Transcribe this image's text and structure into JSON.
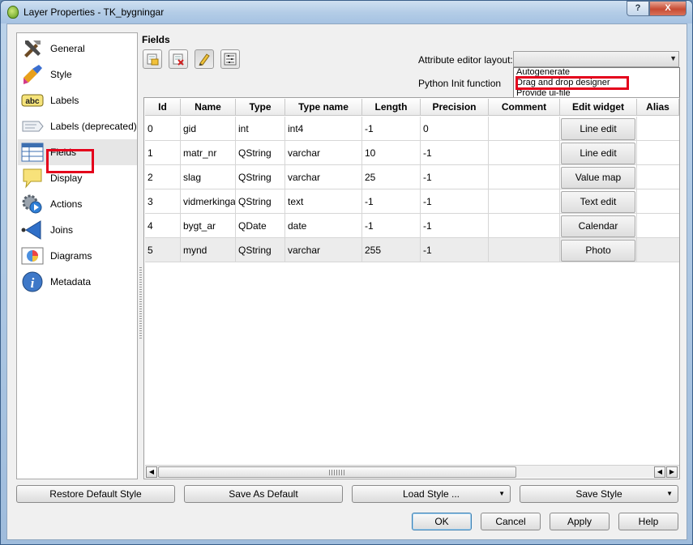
{
  "window": {
    "title": "Layer Properties - TK_bygningar",
    "help_label": "?",
    "close_label": "X"
  },
  "sidebar": {
    "items": [
      {
        "label": "General",
        "icon": "tools-icon"
      },
      {
        "label": "Style",
        "icon": "paintbrush-icon"
      },
      {
        "label": "Labels",
        "icon": "abc-label-icon"
      },
      {
        "label": "Labels (deprecated)",
        "icon": "label-tag-icon"
      },
      {
        "label": "Fields",
        "icon": "table-icon"
      },
      {
        "label": "Display",
        "icon": "speech-bubble-icon"
      },
      {
        "label": "Actions",
        "icon": "gear-play-icon"
      },
      {
        "label": "Joins",
        "icon": "join-arrow-icon"
      },
      {
        "label": "Diagrams",
        "icon": "pie-chart-icon"
      },
      {
        "label": "Metadata",
        "icon": "info-icon"
      }
    ],
    "selected": "Fields"
  },
  "main": {
    "title": "Fields",
    "toolbar": [
      {
        "name": "new-field",
        "icon": "new-field-icon"
      },
      {
        "name": "delete-field",
        "icon": "delete-field-icon"
      },
      {
        "name": "toggle-editing",
        "icon": "pencil-icon",
        "checked": true
      },
      {
        "name": "field-calculator",
        "icon": "calculator-icon"
      }
    ],
    "attr_editor_label": "Attribute editor layout:",
    "python_init_label": "Python Init function",
    "layout_combo": {
      "value": "",
      "options": [
        "Autogenerate",
        "Drag and drop designer",
        "Provide ui-file"
      ]
    }
  },
  "table": {
    "columns": [
      "Id",
      "Name",
      "Type",
      "Type name",
      "Length",
      "Precision",
      "Comment",
      "Edit widget",
      "Alias"
    ],
    "rows": [
      {
        "id": "0",
        "name": "gid",
        "type": "int",
        "typename": "int4",
        "length": "-1",
        "precision": "0",
        "comment": "",
        "widget": "Line edit",
        "alias": ""
      },
      {
        "id": "1",
        "name": "matr_nr",
        "type": "QString",
        "typename": "varchar",
        "length": "10",
        "precision": "-1",
        "comment": "",
        "widget": "Line edit",
        "alias": ""
      },
      {
        "id": "2",
        "name": "slag",
        "type": "QString",
        "typename": "varchar",
        "length": "25",
        "precision": "-1",
        "comment": "",
        "widget": "Value map",
        "alias": ""
      },
      {
        "id": "3",
        "name": "vidmerkingar",
        "type": "QString",
        "typename": "text",
        "length": "-1",
        "precision": "-1",
        "comment": "",
        "widget": "Text edit",
        "alias": ""
      },
      {
        "id": "4",
        "name": "bygt_ar",
        "type": "QDate",
        "typename": "date",
        "length": "-1",
        "precision": "-1",
        "comment": "",
        "widget": "Calendar",
        "alias": ""
      },
      {
        "id": "5",
        "name": "mynd",
        "type": "QString",
        "typename": "varchar",
        "length": "255",
        "precision": "-1",
        "comment": "",
        "widget": "Photo",
        "alias": ""
      }
    ],
    "selected_row": 5
  },
  "buttons": {
    "restore_default_style": "Restore Default Style",
    "save_as_default": "Save As Default",
    "load_style": "Load Style ...",
    "save_style": "Save Style",
    "ok": "OK",
    "cancel": "Cancel",
    "apply": "Apply",
    "help": "Help"
  },
  "colors": {
    "highlight_red": "#e4001b",
    "selected_row_bg": "#ececec"
  }
}
